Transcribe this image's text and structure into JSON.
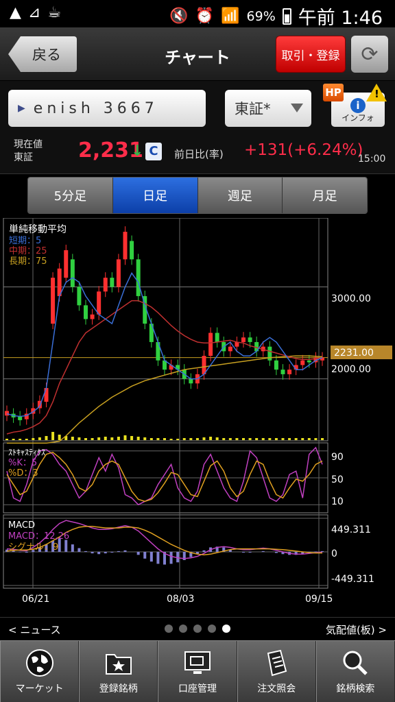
{
  "status_bar": {
    "left_icons": [
      "warning-icon",
      "chart-icon",
      "cup-icon"
    ],
    "battery": "69%",
    "time": "午前 1:46"
  },
  "header": {
    "back_label": "戻る",
    "title": "チャート",
    "trade_label": "取引・登録"
  },
  "stock": {
    "name_code": "enish 3667",
    "market": "東証*",
    "info_label": "インフォ",
    "hp_badge": "HP",
    "warn_badge": "!",
    "cur_label_1": "現在値",
    "cur_label_2": "東証",
    "price": "2,231",
    "price_arrow": "↓",
    "price_flag": "C",
    "chg_label": "前日比(率)",
    "chg_value": "+131(+6.24%)",
    "time": "15:00"
  },
  "tabs": [
    {
      "label": "5分足",
      "active": false
    },
    {
      "label": "日足",
      "active": true
    },
    {
      "label": "週足",
      "active": false
    },
    {
      "label": "月足",
      "active": false
    }
  ],
  "chart": {
    "main_title": "単純移動平均",
    "legend": [
      {
        "label": "短期：5",
        "color": "#3a6fd8"
      },
      {
        "label": "中期：25",
        "color": "#c03030"
      },
      {
        "label": "長期：75",
        "color": "#c8a020"
      }
    ],
    "price_ticks": [
      "3000.00",
      "2000.00"
    ],
    "current_tag": "2231.00",
    "stoch_title": "ｽﾄｷｬｽﾃｨｸｽ",
    "stoch_legend": [
      {
        "label": "%K：5",
        "color": "#c040c0"
      },
      {
        "label": "%D：3",
        "color": "#e0a020"
      }
    ],
    "stoch_ticks": [
      "90",
      "50",
      "10"
    ],
    "macd_title": "MACD",
    "macd_legend": [
      {
        "label": "MACD：12,26",
        "color": "#c040c0"
      },
      {
        "label": "シグナル：9",
        "color": "#e0a020"
      }
    ],
    "macd_ticks": [
      "449.311",
      "0",
      "-449.311"
    ],
    "date_labels": [
      "06/21",
      "08/03",
      "09/15"
    ]
  },
  "chart_data": {
    "type": "candlestick",
    "last_close": 2231.0,
    "ylim": [
      1400,
      3750
    ],
    "short_ma": [
      1620,
      1600,
      1590,
      1600,
      1640,
      1700,
      1900,
      2400,
      2900,
      3050,
      3100,
      3050,
      2900,
      2800,
      2700,
      2650,
      2600,
      2800,
      3000,
      3150,
      3050,
      2800,
      2600,
      2400,
      2200,
      2150,
      2100,
      2050,
      2000,
      2000,
      2050,
      2150,
      2250,
      2350,
      2400,
      2300,
      2250,
      2250,
      2300,
      2400,
      2450,
      2400,
      2300,
      2200,
      2100,
      2100,
      2150,
      2200,
      2230
    ],
    "mid_ma": [
      1400,
      1420,
      1430,
      1450,
      1480,
      1520,
      1600,
      1750,
      1950,
      2100,
      2250,
      2400,
      2500,
      2550,
      2600,
      2650,
      2700,
      2750,
      2800,
      2850,
      2850,
      2820,
      2780,
      2720,
      2650,
      2580,
      2520,
      2470,
      2430,
      2400,
      2390,
      2390,
      2400,
      2410,
      2420,
      2400,
      2390,
      2360,
      2340,
      2320,
      2300,
      2280,
      2260,
      2240,
      2220,
      2210,
      2210,
      2220,
      2230
    ],
    "long_ma": [
      1300,
      1300,
      1300,
      1300,
      1300,
      1300,
      1300,
      1310,
      1320,
      1380,
      1450,
      1520,
      1580,
      1640,
      1700,
      1750,
      1800,
      1840,
      1880,
      1920,
      1950,
      1980,
      2000,
      2020,
      2040,
      2060,
      2080,
      2100,
      2110,
      2120,
      2130,
      2140,
      2150,
      2160,
      2170,
      2180,
      2190,
      2200,
      2210,
      2220,
      2230,
      2235,
      2240,
      2245,
      2250,
      2250,
      2250,
      2245,
      2240
    ],
    "candles": [
      [
        1600,
        1650
      ],
      [
        1620,
        1580
      ],
      [
        1590,
        1550
      ],
      [
        1560,
        1620
      ],
      [
        1620,
        1680
      ],
      [
        1680,
        1760
      ],
      [
        1750,
        1900
      ],
      [
        2600,
        3100
      ],
      [
        2900,
        3200
      ],
      [
        3100,
        3400
      ],
      [
        3300,
        3000
      ],
      [
        3000,
        2800
      ],
      [
        2800,
        2650
      ],
      [
        2650,
        2700
      ],
      [
        2700,
        2950
      ],
      [
        2950,
        3100
      ],
      [
        3100,
        3000
      ],
      [
        3000,
        3300
      ],
      [
        3300,
        3600
      ],
      [
        3500,
        3300
      ],
      [
        3300,
        2900
      ],
      [
        2900,
        2600
      ],
      [
        2600,
        2400
      ],
      [
        2400,
        2200
      ],
      [
        2200,
        2100
      ],
      [
        2100,
        2150
      ],
      [
        2150,
        2100
      ],
      [
        2100,
        2000
      ],
      [
        2000,
        1950
      ],
      [
        1950,
        2050
      ],
      [
        2050,
        2250
      ],
      [
        2250,
        2500
      ],
      [
        2500,
        2400
      ],
      [
        2400,
        2300
      ],
      [
        2300,
        2350
      ],
      [
        2350,
        2400
      ],
      [
        2400,
        2450
      ],
      [
        2450,
        2400
      ],
      [
        2400,
        2300
      ],
      [
        2300,
        2350
      ],
      [
        2350,
        2200
      ],
      [
        2200,
        2100
      ],
      [
        2100,
        2050
      ],
      [
        2050,
        2100
      ],
      [
        2100,
        2150
      ],
      [
        2150,
        2200
      ],
      [
        2200,
        2180
      ],
      [
        2180,
        2231
      ],
      [
        2200,
        2231
      ]
    ],
    "volume": [
      2,
      2,
      2,
      2,
      3,
      4,
      6,
      12,
      8,
      6,
      5,
      4,
      3,
      3,
      4,
      5,
      4,
      5,
      7,
      6,
      5,
      4,
      3,
      3,
      3,
      2,
      2,
      3,
      3,
      3,
      4,
      5,
      4,
      3,
      3,
      3,
      3,
      3,
      3,
      3,
      3,
      3,
      3,
      3,
      3,
      3,
      3,
      3,
      3
    ],
    "stoch_k": [
      60,
      20,
      15,
      40,
      75,
      90,
      92,
      85,
      70,
      60,
      40,
      20,
      30,
      55,
      80,
      60,
      85,
      65,
      25,
      20,
      10,
      15,
      20,
      40,
      55,
      70,
      35,
      20,
      15,
      30,
      70,
      85,
      60,
      35,
      20,
      15,
      45,
      90,
      80,
      50,
      20,
      15,
      25,
      55,
      60,
      20,
      85,
      95,
      70
    ],
    "stoch_d": [
      55,
      40,
      25,
      30,
      50,
      70,
      85,
      88,
      80,
      70,
      55,
      35,
      30,
      40,
      60,
      70,
      75,
      70,
      50,
      30,
      18,
      15,
      18,
      28,
      42,
      58,
      55,
      40,
      25,
      22,
      45,
      68,
      75,
      60,
      35,
      22,
      30,
      55,
      75,
      70,
      45,
      25,
      20,
      35,
      48,
      45,
      55,
      70,
      75
    ],
    "macd": [
      40,
      35,
      20,
      15,
      60,
      120,
      200,
      300,
      380,
      420,
      400,
      380,
      350,
      320,
      300,
      300,
      310,
      330,
      350,
      330,
      280,
      200,
      120,
      40,
      -20,
      -60,
      -80,
      -90,
      -80,
      -60,
      -20,
      30,
      60,
      70,
      60,
      40,
      30,
      30,
      40,
      50,
      40,
      20,
      0,
      -20,
      -30,
      -30,
      -20,
      -10,
      -5
    ],
    "signal": [
      10,
      20,
      25,
      25,
      35,
      60,
      100,
      150,
      200,
      260,
      300,
      330,
      340,
      340,
      330,
      320,
      320,
      320,
      330,
      330,
      320,
      290,
      250,
      200,
      150,
      100,
      60,
      20,
      -10,
      -30,
      -40,
      -30,
      -10,
      10,
      30,
      40,
      40,
      40,
      40,
      40,
      40,
      35,
      30,
      20,
      10,
      0,
      -10,
      -15,
      -15
    ]
  },
  "news_bar": {
    "left": "< ニュース",
    "right": "気配値(板) >",
    "page_dots": 5,
    "active_dot": 4
  },
  "bottom_nav": [
    {
      "label": "マーケット",
      "icon": "globe-icon"
    },
    {
      "label": "登録銘柄",
      "icon": "star-folder-icon"
    },
    {
      "label": "口座管理",
      "icon": "monitor-icon"
    },
    {
      "label": "注文照会",
      "icon": "document-icon"
    },
    {
      "label": "銘柄検索",
      "icon": "magnifier-icon"
    }
  ]
}
